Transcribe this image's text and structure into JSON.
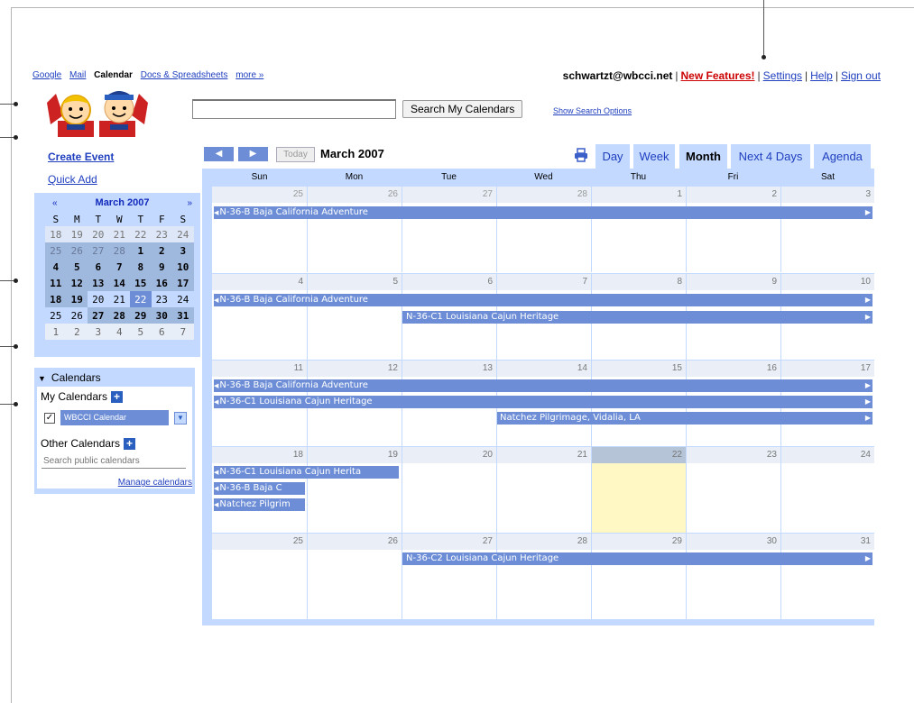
{
  "topnav": {
    "items": [
      "Google",
      "Mail",
      "Calendar",
      "Docs & Spreadsheets",
      "more »"
    ],
    "current": "Calendar"
  },
  "user": {
    "email": "schwartzt@wbcci.net",
    "sep": "|",
    "new_features": "New Features!",
    "settings": "Settings",
    "help": "Help",
    "sign_out": "Sign out"
  },
  "search": {
    "button": "Search My Calendars",
    "options_link": "Show Search Options"
  },
  "sidebar": {
    "create_event": "Create Event",
    "quick_add": "Quick Add",
    "mini_cal": {
      "prev": "«",
      "next": "»",
      "title": "March 2007",
      "dow": [
        "S",
        "M",
        "T",
        "W",
        "T",
        "F",
        "S"
      ],
      "weeks": [
        [
          "18",
          "19",
          "20",
          "21",
          "22",
          "23",
          "24"
        ],
        [
          "25",
          "26",
          "27",
          "28",
          "1",
          "2",
          "3"
        ],
        [
          "4",
          "5",
          "6",
          "7",
          "8",
          "9",
          "10"
        ],
        [
          "11",
          "12",
          "13",
          "14",
          "15",
          "16",
          "17"
        ],
        [
          "18",
          "19",
          "20",
          "21",
          "22",
          "23",
          "24"
        ],
        [
          "25",
          "26",
          "27",
          "28",
          "29",
          "30",
          "31"
        ],
        [
          "1",
          "2",
          "3",
          "4",
          "5",
          "6",
          "7"
        ]
      ]
    },
    "calendars": {
      "title": "Calendars",
      "my_calendars": "My Calendars",
      "wbcci": "WBCCI Calendar",
      "other_calendars": "Other Calendars",
      "search_placeholder": "Search public calendars",
      "manage": "Manage calendars"
    }
  },
  "toolbar": {
    "prev": "◀",
    "next": "▶",
    "today": "Today",
    "date_label": "March 2007",
    "views": [
      "Day",
      "Week",
      "Month",
      "Next 4 Days",
      "Agenda"
    ],
    "active_view": "Month"
  },
  "grid": {
    "dow": [
      "Sun",
      "Mon",
      "Tue",
      "Wed",
      "Thu",
      "Fri",
      "Sat"
    ],
    "weeks": [
      [
        "25",
        "26",
        "27",
        "28",
        "1",
        "2",
        "3"
      ],
      [
        "4",
        "5",
        "6",
        "7",
        "8",
        "9",
        "10"
      ],
      [
        "11",
        "12",
        "13",
        "14",
        "15",
        "16",
        "17"
      ],
      [
        "18",
        "19",
        "20",
        "21",
        "22",
        "23",
        "24"
      ],
      [
        "25",
        "26",
        "27",
        "28",
        "29",
        "30",
        "31"
      ]
    ],
    "events": {
      "baja": "N-36-B Baja California Adventure",
      "cajun_c1": "N-36-C1 Louisiana Cajun Heritage",
      "natchez": "Natchez Pilgrimage, Vidalia, LA",
      "cajun_c1_short": "N-36-C1 Louisiana Cajun Herita",
      "baja_short": "N-36-B Baja C",
      "natchez_short": "Natchez Pilgrim",
      "cajun_c2": "N-36-C2 Louisiana Cajun Heritage"
    }
  },
  "colors": {
    "accent": "#c3d9ff",
    "event": "#6d8ed6",
    "today": "#fff8c4",
    "link": "#1f3fbf",
    "new_features": "#cc0000"
  }
}
